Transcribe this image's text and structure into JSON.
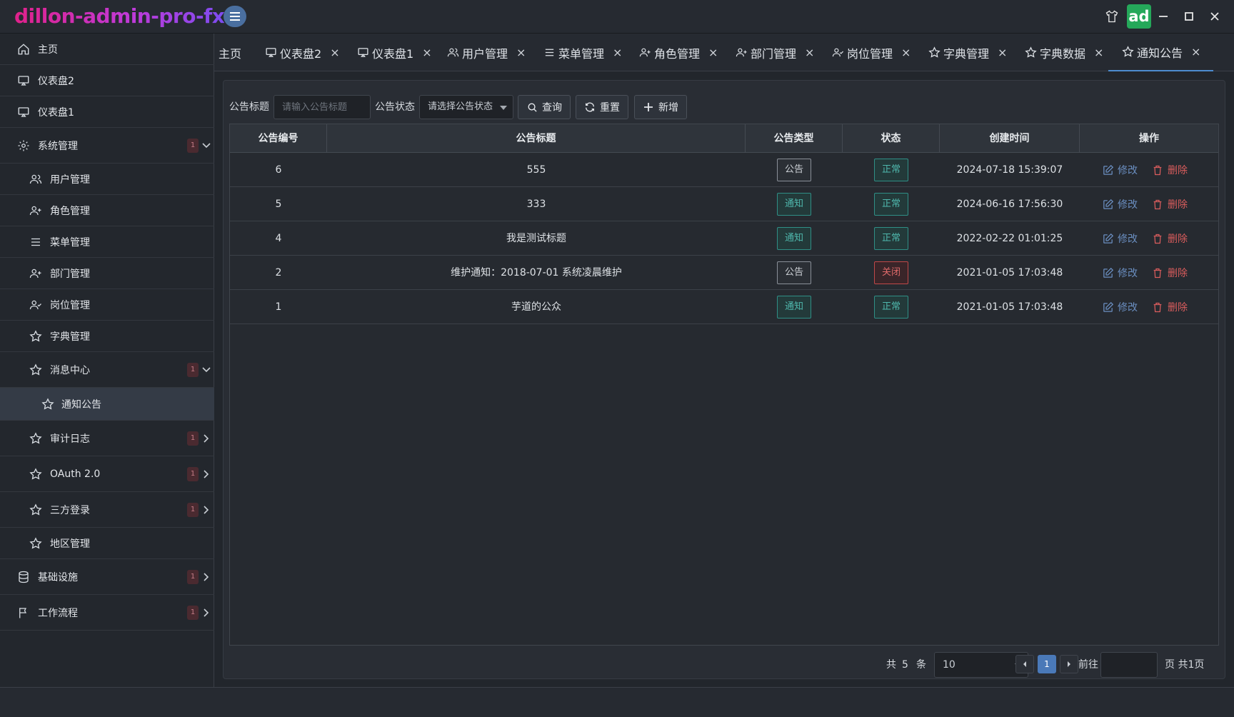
{
  "app": {
    "title": "dillon-admin-pro-fx",
    "avatar_text": "ad"
  },
  "sidebar": {
    "items": [
      {
        "label": "主页",
        "icon": "home-icon"
      },
      {
        "label": "仪表盘2",
        "icon": "monitor-icon"
      },
      {
        "label": "仪表盘1",
        "icon": "monitor-icon"
      },
      {
        "label": "系统管理",
        "icon": "gear-icon",
        "badge": "1"
      },
      {
        "label": "用户管理",
        "icon": "users-icon"
      },
      {
        "label": "角色管理",
        "icon": "user-plus-icon"
      },
      {
        "label": "菜单管理",
        "icon": "list-icon"
      },
      {
        "label": "部门管理",
        "icon": "user-plus-icon"
      },
      {
        "label": "岗位管理",
        "icon": "user-check-icon"
      },
      {
        "label": "字典管理",
        "icon": "star-icon"
      },
      {
        "label": "消息中心",
        "icon": "star-icon",
        "badge": "1"
      },
      {
        "label": "通知公告",
        "icon": "star-icon"
      },
      {
        "label": "审计日志",
        "icon": "star-icon",
        "badge": "1"
      },
      {
        "label": "OAuth 2.0",
        "icon": "star-icon",
        "badge": "1"
      },
      {
        "label": "三方登录",
        "icon": "star-icon",
        "badge": "1"
      },
      {
        "label": "地区管理",
        "icon": "star-icon"
      },
      {
        "label": "基础设施",
        "icon": "database-icon",
        "badge": "1"
      },
      {
        "label": "工作流程",
        "icon": "flag-icon",
        "badge": "1"
      }
    ]
  },
  "tabs": [
    {
      "label": "主页"
    },
    {
      "label": "仪表盘2"
    },
    {
      "label": "仪表盘1"
    },
    {
      "label": "用户管理"
    },
    {
      "label": "菜单管理"
    },
    {
      "label": "角色管理"
    },
    {
      "label": "部门管理"
    },
    {
      "label": "岗位管理"
    },
    {
      "label": "字典管理"
    },
    {
      "label": "字典数据"
    },
    {
      "label": "通知公告"
    }
  ],
  "tab_close": "×",
  "search": {
    "title_label": "公告标题",
    "title_placeholder": "请输入公告标题",
    "status_label": "公告状态",
    "status_placeholder": "请选择公告状态",
    "query_btn": "查询",
    "reset_btn": "重置",
    "add_btn": "新增"
  },
  "table": {
    "headers": [
      "公告编号",
      "公告标题",
      "公告类型",
      "状态",
      "创建时间",
      "操作"
    ],
    "edit_label": "修改",
    "delete_label": "删除",
    "rows": [
      {
        "id": "6",
        "title": "555",
        "type": "公告",
        "status": "正常",
        "created": "2024-07-18 15:39:07"
      },
      {
        "id": "5",
        "title": "333",
        "type": "通知",
        "status": "正常",
        "created": "2024-06-16 17:56:30"
      },
      {
        "id": "4",
        "title": "我是测试标题",
        "type": "通知",
        "status": "正常",
        "created": "2022-02-22 01:01:25"
      },
      {
        "id": "2",
        "title": "维护通知：2018-07-01 系统凌晨维护",
        "type": "公告",
        "status": "关闭",
        "created": "2021-01-05 17:03:48"
      },
      {
        "id": "1",
        "title": "芋道的公众",
        "type": "通知",
        "status": "正常",
        "created": "2021-01-05 17:03:48"
      }
    ]
  },
  "pagination": {
    "total_prefix": "共",
    "total": "5",
    "total_suffix": "条",
    "page_size": "10",
    "current_page": "1",
    "goto_label": "前往",
    "page_suffix": "页 共1页"
  },
  "colors": {
    "accent": "#4a79b8",
    "brand_start": "#e0218a",
    "brand_end": "#7d4cf0",
    "teal": "#4fb8ad",
    "danger": "#d85c5c"
  }
}
